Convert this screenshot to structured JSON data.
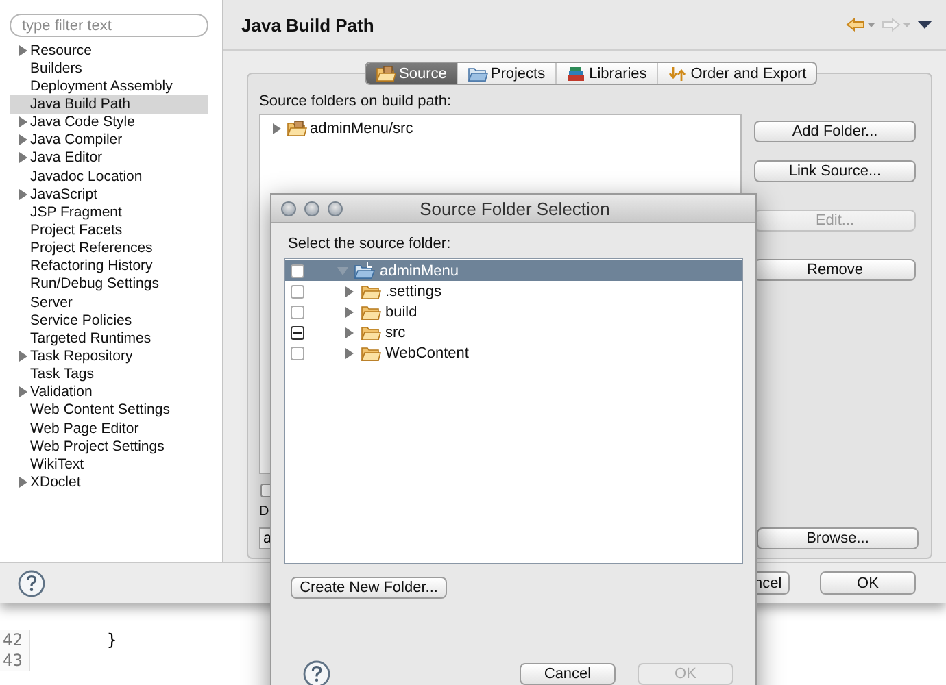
{
  "preferences_window": {
    "filter": {
      "placeholder": "type filter text"
    },
    "nav_items": [
      {
        "label": "Resource",
        "expandable": true,
        "selected": false
      },
      {
        "label": "Builders",
        "expandable": false,
        "selected": false
      },
      {
        "label": "Deployment Assembly",
        "expandable": false,
        "selected": false
      },
      {
        "label": "Java Build Path",
        "expandable": false,
        "selected": true
      },
      {
        "label": "Java Code Style",
        "expandable": true,
        "selected": false
      },
      {
        "label": "Java Compiler",
        "expandable": true,
        "selected": false
      },
      {
        "label": "Java Editor",
        "expandable": true,
        "selected": false
      },
      {
        "label": "Javadoc Location",
        "expandable": false,
        "selected": false
      },
      {
        "label": "JavaScript",
        "expandable": true,
        "selected": false
      },
      {
        "label": "JSP Fragment",
        "expandable": false,
        "selected": false
      },
      {
        "label": "Project Facets",
        "expandable": false,
        "selected": false
      },
      {
        "label": "Project References",
        "expandable": false,
        "selected": false
      },
      {
        "label": "Refactoring History",
        "expandable": false,
        "selected": false
      },
      {
        "label": "Run/Debug Settings",
        "expandable": false,
        "selected": false
      },
      {
        "label": "Server",
        "expandable": false,
        "selected": false
      },
      {
        "label": "Service Policies",
        "expandable": false,
        "selected": false
      },
      {
        "label": "Targeted Runtimes",
        "expandable": false,
        "selected": false
      },
      {
        "label": "Task Repository",
        "expandable": true,
        "selected": false
      },
      {
        "label": "Task Tags",
        "expandable": false,
        "selected": false
      },
      {
        "label": "Validation",
        "expandable": true,
        "selected": false
      },
      {
        "label": "Web Content Settings",
        "expandable": false,
        "selected": false
      },
      {
        "label": "Web Page Editor",
        "expandable": false,
        "selected": false
      },
      {
        "label": "Web Project Settings",
        "expandable": false,
        "selected": false
      },
      {
        "label": "WikiText",
        "expandable": false,
        "selected": false
      },
      {
        "label": "XDoclet",
        "expandable": true,
        "selected": false
      }
    ],
    "page_title": "Java Build Path",
    "tabs": [
      {
        "label": "Source",
        "selected": true
      },
      {
        "label": "Projects",
        "selected": false
      },
      {
        "label": "Libraries",
        "selected": false
      },
      {
        "label": "Order and Export",
        "selected": false
      }
    ],
    "source_label": "Source folders on build path:",
    "source_folders": [
      {
        "label": "adminMenu/src",
        "expanded": false
      }
    ],
    "side_buttons": [
      {
        "label": "Add Folder...",
        "disabled": false
      },
      {
        "label": "Link Source...",
        "disabled": false
      },
      {
        "label": "Edit...",
        "disabled": true
      },
      {
        "label": "Remove",
        "disabled": false
      }
    ],
    "bottom_checkbox": {
      "checked": false
    },
    "output_label": "D",
    "output_field": {
      "value": "a"
    },
    "browse_button": "Browse...",
    "bottom_buttons": [
      {
        "label": "ncel"
      },
      {
        "label": "OK"
      }
    ]
  },
  "editor": {
    "lines": [
      {
        "number": "42",
        "code": "}"
      },
      {
        "number": "43"
      }
    ]
  },
  "dialog": {
    "title": "Source Folder Selection",
    "prompt": "Select the source folder:",
    "tree": {
      "label": "adminMenu",
      "checked": false,
      "partial": false,
      "expanded": true,
      "selected": true,
      "children": [
        {
          "label": ".settings",
          "checked": false,
          "partial": false,
          "expanded": false,
          "selected": false
        },
        {
          "label": "build",
          "checked": false,
          "partial": false,
          "expanded": false,
          "selected": false
        },
        {
          "label": "src",
          "checked": false,
          "partial": true,
          "expanded": false,
          "selected": false
        },
        {
          "label": "WebContent",
          "checked": false,
          "partial": false,
          "expanded": false,
          "selected": false
        }
      ]
    },
    "create_button": "Create New Folder...",
    "buttons": [
      {
        "label": "Cancel",
        "disabled": false
      },
      {
        "label": "OK",
        "disabled": true
      }
    ]
  }
}
